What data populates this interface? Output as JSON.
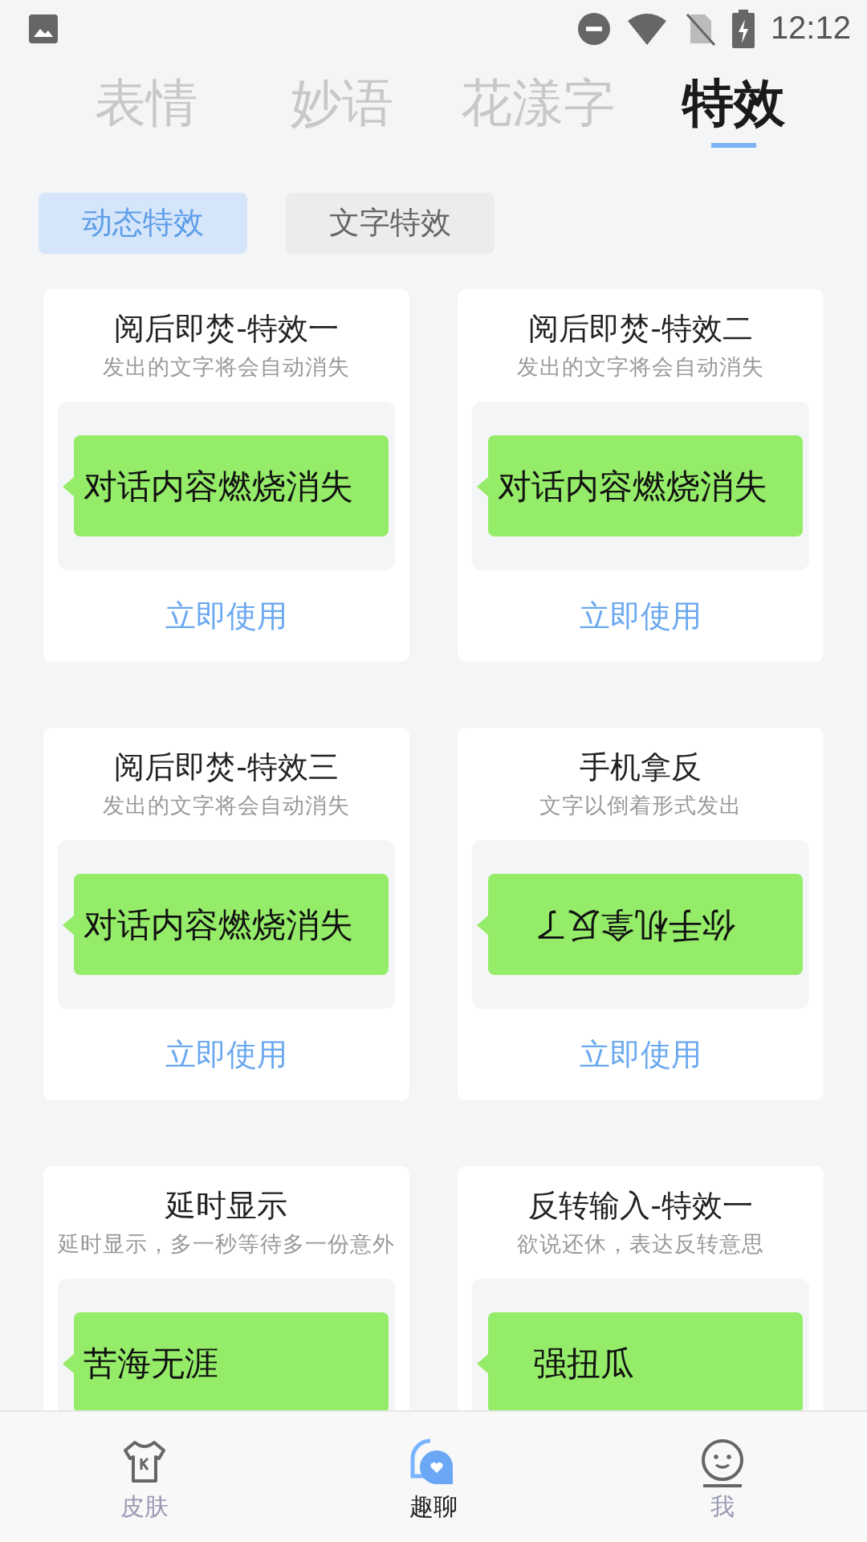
{
  "status_bar": {
    "time": "12:12"
  },
  "tabs": [
    {
      "label": "表情",
      "selected": false
    },
    {
      "label": "妙语",
      "selected": false
    },
    {
      "label": "花漾字",
      "selected": false
    },
    {
      "label": "特效",
      "selected": true
    }
  ],
  "segments": [
    {
      "label": "动态特效",
      "selected": true
    },
    {
      "label": "文字特效",
      "selected": false
    }
  ],
  "cards": [
    {
      "title": "阅后即焚-特效一",
      "subtitle": "发出的文字将会自动消失",
      "preview": {
        "text": "对话内容燃烧消失",
        "kind": "normal"
      },
      "action": "立即使用"
    },
    {
      "title": "阅后即焚-特效二",
      "subtitle": "发出的文字将会自动消失",
      "preview": {
        "text": "对话内容燃烧消失",
        "kind": "normal"
      },
      "action": "立即使用"
    },
    {
      "title": "阅后即焚-特效三",
      "subtitle": "发出的文字将会自动消失",
      "preview": {
        "text": "对话内容燃烧消失",
        "kind": "normal"
      },
      "action": "立即使用"
    },
    {
      "title": "手机拿反",
      "subtitle": "文字以倒着形式发出",
      "preview": {
        "text": "你手机拿反了",
        "kind": "flipped"
      },
      "action": "立即使用"
    },
    {
      "title": "延时显示",
      "subtitle": "延时显示，多一秒等待多一份意外",
      "preview": {
        "text": "苦海无涯",
        "kind": "normal"
      }
    },
    {
      "title": "反转输入-特效一",
      "subtitle": "欲说还休，表达反转意思",
      "preview": {
        "text": "强扭瓜",
        "kind": "indented"
      }
    }
  ],
  "bottom_nav": [
    {
      "label": "皮肤",
      "selected": false
    },
    {
      "label": "趣聊",
      "selected": true
    },
    {
      "label": "我",
      "selected": false
    }
  ]
}
